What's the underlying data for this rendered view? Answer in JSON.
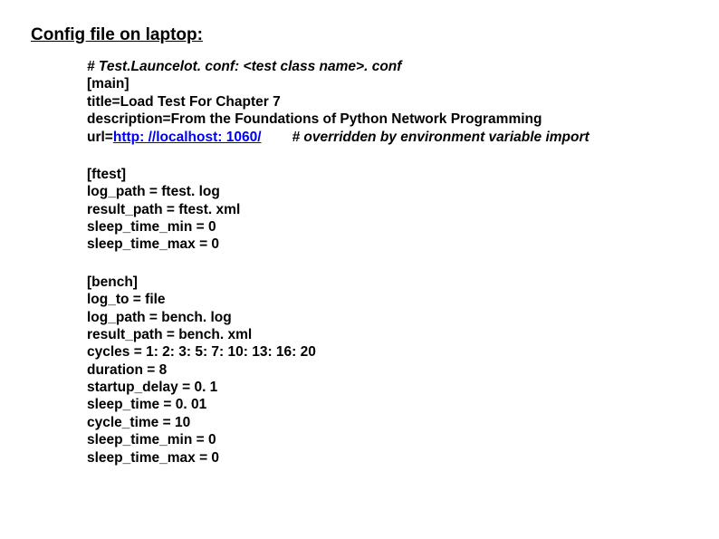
{
  "heading": "Config file on laptop:",
  "comment": "# Test.Launcelot. conf: <test class name>. conf",
  "main": {
    "section": "[main]",
    "title": "title=Load Test For Chapter 7",
    "description": "description=From the Foundations of Python Network Programming",
    "url_prefix": "url=",
    "url_link": "http: //localhost: 1060/",
    "url_suffix": "#   overridden by environment variable import"
  },
  "ftest": {
    "section": "[ftest]",
    "log_path": "log_path = ftest. log",
    "result_path": "result_path = ftest. xml",
    "sleep_time_min": "sleep_time_min = 0",
    "sleep_time_max": "sleep_time_max = 0"
  },
  "bench": {
    "section": "[bench]",
    "log_to": "log_to = file",
    "log_path": "log_path = bench. log",
    "result_path": "result_path = bench. xml",
    "cycles": "cycles = 1: 2: 3: 5: 7: 10: 13: 16: 20",
    "duration": "duration = 8",
    "startup_delay": "startup_delay = 0. 1",
    "sleep_time": "sleep_time = 0. 01",
    "cycle_time": "cycle_time = 10",
    "sleep_time_min": "sleep_time_min = 0",
    "sleep_time_max": "sleep_time_max = 0"
  }
}
